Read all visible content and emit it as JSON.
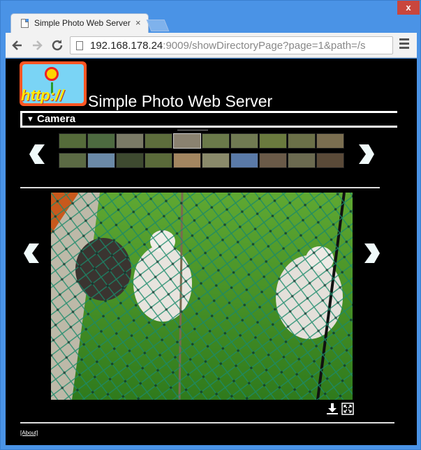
{
  "browser": {
    "tab_title": "Simple Photo Web Server",
    "tab_close": "×",
    "window_close": "x",
    "url_host": "192.168.178.24",
    "url_rest": ":9009/showDirectoryPage?page=1&path=/s",
    "back_icon": "back-arrow-icon",
    "forward_icon": "forward-arrow-icon",
    "reload_icon": "reload-icon",
    "menu_icon": "hamburger-menu-icon"
  },
  "page": {
    "logo_text": "http://",
    "site_title": "Simple Photo Web Server",
    "directory_name": "Camera",
    "expand_icon": "triangle-down-icon",
    "about_label": "[About]",
    "download_icon": "download-icon",
    "fullscreen_icon": "fullscreen-icon"
  },
  "thumbnails": {
    "row1_count": 10,
    "row2_count": 10,
    "selected_index": 4,
    "colors": [
      "#556b3a",
      "#4d6a40",
      "#7a7a66",
      "#5d6d3c",
      "#8a8270",
      "#6b7a4a",
      "#707a52",
      "#6a7a3e",
      "#6b7048",
      "#7a6e50",
      "#5b6a44",
      "#6b8aa8",
      "#3e4a30",
      "#5a6a3a",
      "#a38660",
      "#8a8a6a",
      "#5a7aa8",
      "#6a5a48",
      "#6b6a50",
      "#5a4a38"
    ]
  },
  "colors": {
    "page_background": "#000000",
    "text": "#ffffff",
    "arrow_fill": "#f0fafa"
  }
}
